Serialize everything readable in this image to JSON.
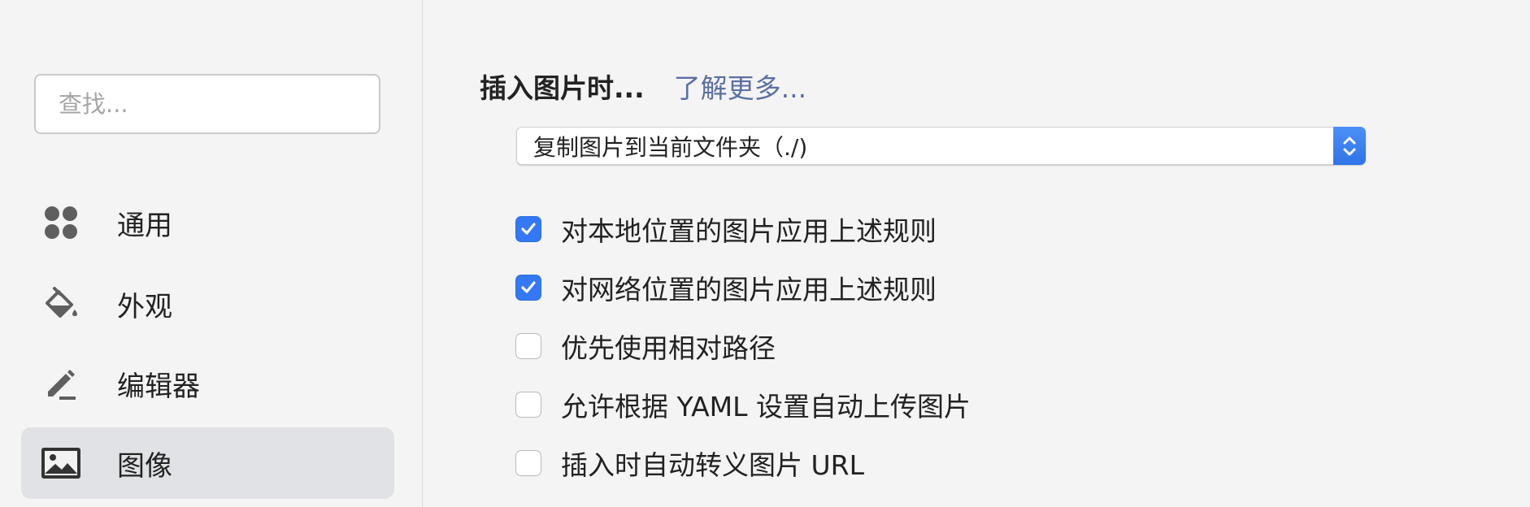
{
  "sidebar": {
    "search_placeholder": "查找...",
    "items": [
      {
        "label": "通用",
        "icon": "general-icon",
        "active": false
      },
      {
        "label": "外观",
        "icon": "paint-bucket-icon",
        "active": false
      },
      {
        "label": "编辑器",
        "icon": "pencil-icon",
        "active": false
      },
      {
        "label": "图像",
        "icon": "image-icon",
        "active": true
      }
    ]
  },
  "main": {
    "heading": "插入图片时...",
    "learn_more": "了解更多...",
    "select_value": "复制图片到当前文件夹（./)",
    "options": [
      {
        "label": "对本地位置的图片应用上述规则",
        "checked": true
      },
      {
        "label": "对网络位置的图片应用上述规则",
        "checked": true
      },
      {
        "label": "优先使用相对路径",
        "checked": false
      },
      {
        "label": "允许根据 YAML 设置自动上传图片",
        "checked": false
      },
      {
        "label": "插入时自动转义图片 URL",
        "checked": false
      }
    ]
  },
  "colors": {
    "accent": "#3478f6",
    "link": "#5b6fa3",
    "close": "#fc5f57"
  }
}
